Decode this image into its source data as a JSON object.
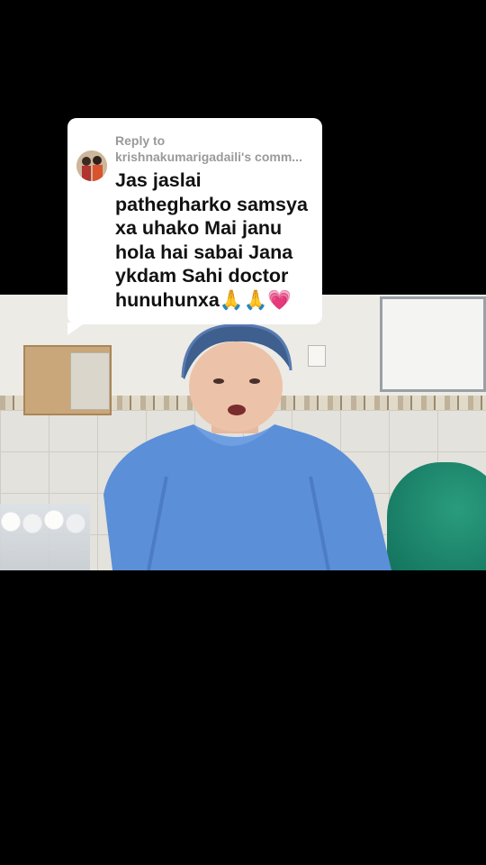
{
  "reply_sticker": {
    "reply_prefix": "Reply to",
    "username": "krishnakumarigadaili's comm...",
    "comment": "Jas jaslai pathegharko samsya xa uhako Mai janu hola hai sabai Jana ykdam Sahi doctor hunuhunxa🙏🙏💗",
    "avatar_icon": "user-avatar-icon"
  },
  "colors": {
    "background": "#000000",
    "bubble": "#ffffff",
    "gown_blue": "#5b8fd8",
    "gown_green": "#14785f"
  }
}
